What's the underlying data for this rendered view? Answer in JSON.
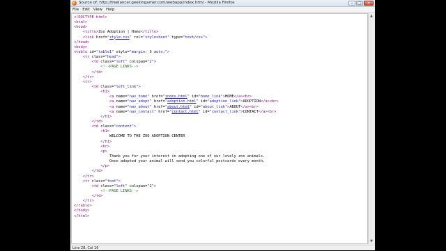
{
  "window": {
    "title": "Source of: http://freelancer.geekingamer.com/webapp/index.html - Mozilla Firefox",
    "menu": [
      {
        "label": "File",
        "name": "menu-file"
      },
      {
        "label": "Edit",
        "name": "menu-edit"
      },
      {
        "label": "View",
        "name": "menu-view"
      },
      {
        "label": "Help",
        "name": "menu-help"
      }
    ]
  },
  "status": {
    "text": "Line 28, Col 16"
  },
  "source_lines": [
    [
      [
        "tg",
        "<!DOCTYPE html>"
      ]
    ],
    [
      [
        "tg",
        "<html>"
      ]
    ],
    [
      [
        "tg",
        "<head>"
      ]
    ],
    [
      [
        "tx",
        "    "
      ],
      [
        "tg",
        "<title>"
      ],
      [
        "tx",
        "Zoo Adoption | Home"
      ],
      [
        "tg",
        "</title>"
      ]
    ],
    [
      [
        "tx",
        "    "
      ],
      [
        "tg",
        "<link "
      ],
      [
        "an",
        "href="
      ],
      [
        "av",
        "\""
      ],
      [
        "lk",
        "style.css"
      ],
      [
        "av",
        "\""
      ],
      [
        "an",
        " rel="
      ],
      [
        "av",
        "\"stylesheet\""
      ],
      [
        "an",
        " type="
      ],
      [
        "av",
        "\"text/css\""
      ],
      [
        "tg",
        ">"
      ]
    ],
    [
      [
        "tg",
        "</head>"
      ]
    ],
    [
      [
        "tg",
        "<body>"
      ]
    ],
    [
      [
        "tg",
        "<table "
      ],
      [
        "an",
        "id="
      ],
      [
        "av",
        "\"table1\""
      ],
      [
        "an",
        " style="
      ],
      [
        "av",
        "\"margin: 0 auto;\""
      ],
      [
        "tg",
        ">"
      ]
    ],
    [
      [
        "tx",
        "    "
      ],
      [
        "tg",
        "<tr "
      ],
      [
        "an",
        "class="
      ],
      [
        "av",
        "\"head\""
      ],
      [
        "tg",
        ">"
      ]
    ],
    [
      [
        "tx",
        "        "
      ],
      [
        "tg",
        "<td "
      ],
      [
        "an",
        "class="
      ],
      [
        "av",
        "\"left\""
      ],
      [
        "an",
        " colspan="
      ],
      [
        "av",
        "\"2\""
      ],
      [
        "tg",
        ">"
      ]
    ],
    [
      [
        "tx",
        "            "
      ],
      [
        "cm",
        "<!--PAGE LINKS-->"
      ]
    ],
    [
      [
        "tx",
        "        "
      ],
      [
        "tg",
        "</td>"
      ]
    ],
    [
      [
        "tx",
        "    "
      ],
      [
        "tg",
        "</tr>"
      ]
    ],
    [
      [
        "tx",
        "    "
      ],
      [
        "tg",
        "<tr>"
      ]
    ],
    [
      [
        "tx",
        "        "
      ],
      [
        "tg",
        "<td "
      ],
      [
        "an",
        "class="
      ],
      [
        "av",
        "\"left_link\""
      ],
      [
        "tg",
        ">"
      ]
    ],
    [
      [
        "tx",
        "            "
      ],
      [
        "tg",
        "<h1>"
      ]
    ],
    [
      [
        "tx",
        "                "
      ],
      [
        "tg",
        "<a "
      ],
      [
        "an",
        "name="
      ],
      [
        "av",
        "\"nav_home\""
      ],
      [
        "an",
        " href="
      ],
      [
        "av",
        "\""
      ],
      [
        "lk",
        "index.html"
      ],
      [
        "av",
        "\""
      ],
      [
        "an",
        " id="
      ],
      [
        "av",
        "\"home_link\""
      ],
      [
        "tg",
        ">"
      ],
      [
        "tx",
        "HOME"
      ],
      [
        "tg",
        "</a><br>"
      ]
    ],
    [
      [
        "tx",
        "                "
      ],
      [
        "tg",
        "<a "
      ],
      [
        "an",
        "name="
      ],
      [
        "av",
        "\"nav_adopt\""
      ],
      [
        "an",
        " href="
      ],
      [
        "av",
        "\""
      ],
      [
        "lk",
        "adoption.html"
      ],
      [
        "av",
        "\""
      ],
      [
        "an",
        " id="
      ],
      [
        "av",
        "\"adoption_link\""
      ],
      [
        "tg",
        ">"
      ],
      [
        "tx",
        "ADOPTION"
      ],
      [
        "tg",
        "</a><br>"
      ]
    ],
    [
      [
        "tx",
        "                "
      ],
      [
        "tg",
        "<a "
      ],
      [
        "an",
        "name="
      ],
      [
        "av",
        "\"nav_about\""
      ],
      [
        "an",
        " href="
      ],
      [
        "av",
        "\""
      ],
      [
        "lk",
        "about.html"
      ],
      [
        "av",
        "\""
      ],
      [
        "an",
        " id="
      ],
      [
        "av",
        "\"about_link\""
      ],
      [
        "tg",
        ">"
      ],
      [
        "tx",
        "ABOUT"
      ],
      [
        "tg",
        "</a><br>"
      ]
    ],
    [
      [
        "tx",
        "                "
      ],
      [
        "tg",
        "<a "
      ],
      [
        "an",
        "name="
      ],
      [
        "av",
        "\"nav_contact\""
      ],
      [
        "an",
        " href="
      ],
      [
        "av",
        "\""
      ],
      [
        "lk",
        "contact.html"
      ],
      [
        "av",
        "\""
      ],
      [
        "an",
        " id="
      ],
      [
        "av",
        "\"contact_link\""
      ],
      [
        "tg",
        ">"
      ],
      [
        "tx",
        "CONTACT"
      ],
      [
        "tg",
        "</a><br>"
      ]
    ],
    [
      [
        "tx",
        "            "
      ],
      [
        "tg",
        "</h1>"
      ]
    ],
    [
      [
        "tx",
        "        "
      ],
      [
        "tg",
        "</td>"
      ]
    ],
    [
      [
        "tx",
        "        "
      ],
      [
        "tg",
        "<td "
      ],
      [
        "an",
        "class="
      ],
      [
        "av",
        "\"content\""
      ],
      [
        "tg",
        ">"
      ]
    ],
    [
      [
        "tx",
        "            "
      ],
      [
        "tg",
        "<h1>"
      ]
    ],
    [
      [
        "tx",
        "                WELCOME TO THE ZOO ADOPTION CENTER"
      ]
    ],
    [
      [
        "tx",
        "            "
      ],
      [
        "tg",
        "</h1>"
      ]
    ],
    [
      [
        "tx",
        "            "
      ],
      [
        "tg",
        "<hr>"
      ]
    ],
    [
      [
        "tx",
        "            "
      ],
      [
        "tg",
        "<p>"
      ]
    ],
    [
      [
        "tx",
        "                Thank you for your interest in adopting one of our lovely zoo animals."
      ]
    ],
    [
      [
        "tx",
        "                Once adopted your animal will send you colorful postcards every month."
      ]
    ],
    [
      [
        "tx",
        "            "
      ],
      [
        "tg",
        "</p>"
      ]
    ],
    [
      [
        "tx",
        "        "
      ],
      [
        "tg",
        "</td>"
      ]
    ],
    [
      [
        "tx",
        "    "
      ],
      [
        "tg",
        "</tr>"
      ]
    ],
    [
      [
        "tx",
        "    "
      ],
      [
        "tg",
        "<tr "
      ],
      [
        "an",
        "class="
      ],
      [
        "av",
        "\"foot\""
      ],
      [
        "tg",
        ">"
      ]
    ],
    [
      [
        "tx",
        "        "
      ],
      [
        "tg",
        "<td "
      ],
      [
        "an",
        "class="
      ],
      [
        "av",
        "\"left\""
      ],
      [
        "an",
        " colspan="
      ],
      [
        "av",
        "\"2\""
      ],
      [
        "tg",
        ">"
      ]
    ],
    [
      [
        "tx",
        "            "
      ],
      [
        "cm",
        "<!--PAGE LINKS-->"
      ]
    ],
    [
      [
        "tx",
        "        "
      ],
      [
        "tg",
        "</td>"
      ]
    ],
    [
      [
        "tx",
        "    "
      ],
      [
        "tg",
        "</tr>"
      ]
    ],
    [
      [
        "tg",
        "</table>"
      ]
    ],
    [
      [
        "tg",
        "</body>"
      ]
    ],
    [
      [
        "tg",
        "</html>"
      ]
    ]
  ]
}
